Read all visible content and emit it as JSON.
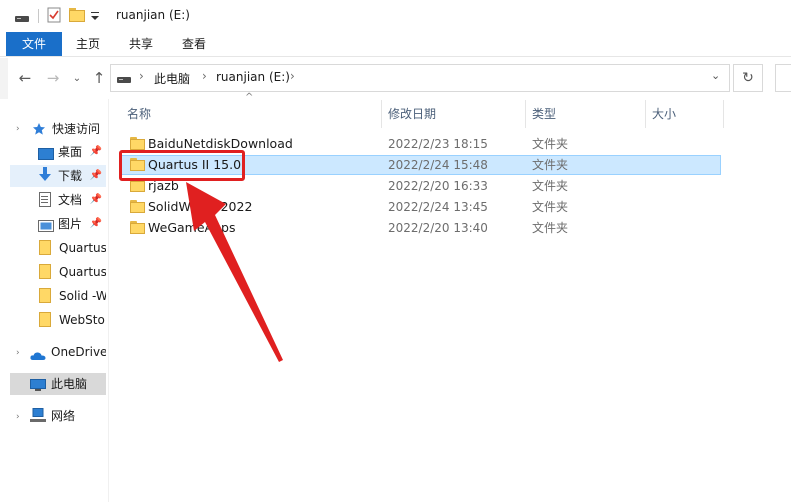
{
  "window": {
    "title": "ruanjian (E:)"
  },
  "ribbon": {
    "tabs": [
      "文件",
      "主页",
      "共享",
      "查看"
    ]
  },
  "address": {
    "crumbs": [
      "此电脑",
      "ruanjian (E:)"
    ]
  },
  "nav": {
    "quick_access": "快速访问",
    "items": [
      {
        "label": "桌面",
        "pinned": true
      },
      {
        "label": "下载",
        "pinned": true
      },
      {
        "label": "文档",
        "pinned": true
      },
      {
        "label": "图片",
        "pinned": true
      },
      {
        "label": "Quartus",
        "pinned": false
      },
      {
        "label": "Quartus",
        "pinned": false
      },
      {
        "label": "Solid -W",
        "pinned": false
      },
      {
        "label": "WebSto",
        "pinned": false
      }
    ],
    "onedrive": "OneDrive",
    "this_pc": "此电脑",
    "network": "网络"
  },
  "list": {
    "headers": {
      "name": "名称",
      "date": "修改日期",
      "type": "类型",
      "size": "大小"
    },
    "rows": [
      {
        "name": "BaiduNetdiskDownload",
        "date": "2022/2/23 18:15",
        "type": "文件夹"
      },
      {
        "name": "Quartus II 15.0",
        "date": "2022/2/24 15:48",
        "type": "文件夹"
      },
      {
        "name": "rjazb",
        "date": "2022/2/20 16:33",
        "type": "文件夹"
      },
      {
        "name": "SolidWorks 2022",
        "date": "2022/2/24 13:45",
        "type": "文件夹"
      },
      {
        "name": "WeGameApps",
        "date": "2022/2/20 13:40",
        "type": "文件夹"
      }
    ]
  },
  "colors": {
    "accent": "#1a6fc9",
    "selection": "#cce8ff",
    "annotation": "#e02020"
  }
}
